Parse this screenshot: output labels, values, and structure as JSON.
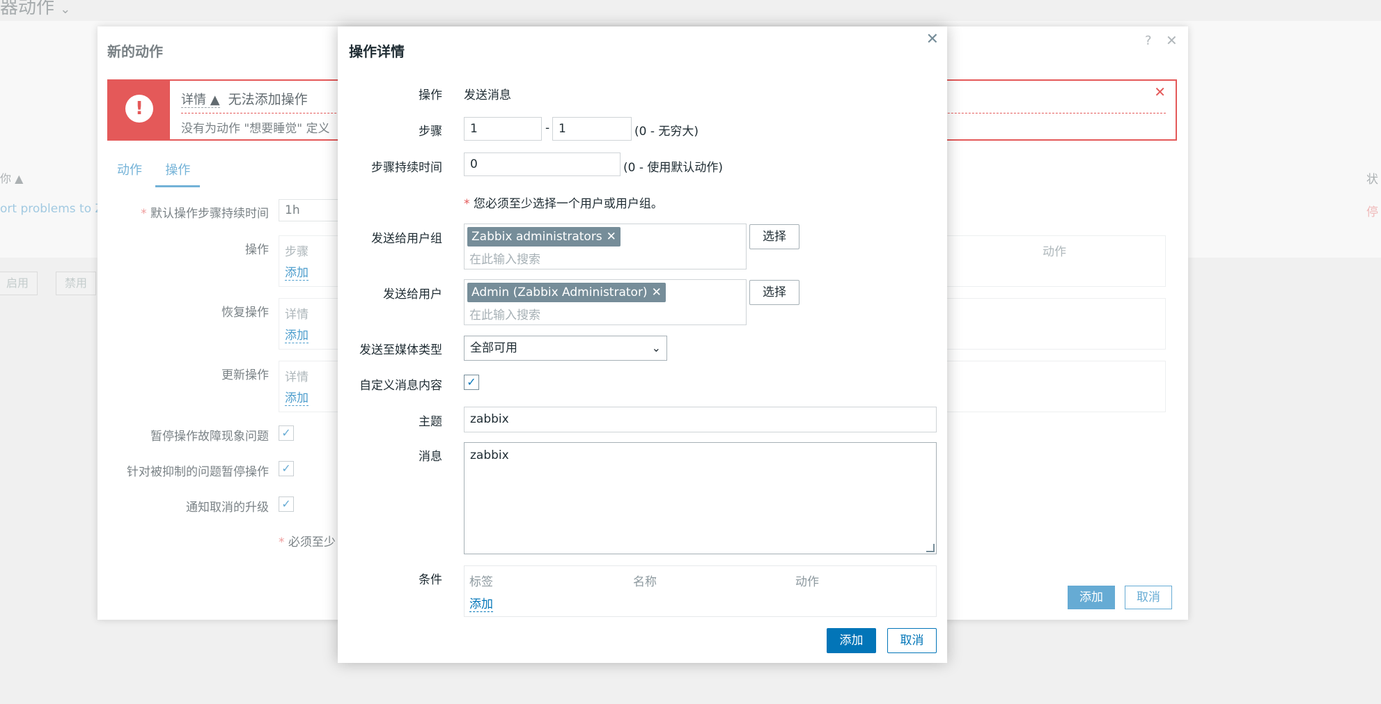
{
  "background": {
    "page_title": "器动作",
    "col_sort": "你 ▲",
    "col_status": "状",
    "row_name": "ort problems to Z",
    "row_status": "停",
    "btn_enable": "启用",
    "btn_disable": "禁用"
  },
  "action_modal": {
    "title": "新的动作",
    "help_icon": "?",
    "close_icon": "✕",
    "alert": {
      "details_label": "详情 ▲",
      "title": "无法添加操作",
      "message": "没有为动作 \"想要睡觉\" 定义",
      "close": "✕"
    },
    "tabs": [
      "动作",
      "操作"
    ],
    "default_step_label": "默认操作步骤持续时间",
    "default_step_value": "1h",
    "operations_label": "操作",
    "operations_header_step": "步骤",
    "operations_header_action": "动作",
    "recovery_label": "恢复操作",
    "update_label": "更新操作",
    "details_header": "详情",
    "add_link": "添加",
    "pause_symptoms_label": "暂停操作故障现象问题",
    "pause_suppressed_label": "针对被抑制的问题暂停操作",
    "notify_cancel_label": "通知取消的升级",
    "required_note": "必须至少",
    "add_button": "添加",
    "cancel_button": "取消"
  },
  "op_modal": {
    "title": "操作详情",
    "close_icon": "✕",
    "operation_label": "操作",
    "operation_value": "发送消息",
    "steps_label": "步骤",
    "step_from": "1",
    "step_sep": "-",
    "step_to": "1",
    "steps_hint": "(0 - 无穷大)",
    "step_duration_label": "步骤持续时间",
    "step_duration_value": "0",
    "step_duration_hint": "(0 - 使用默认动作)",
    "required_note": "您必须至少选择一个用户或用户组。",
    "send_groups_label": "发送给用户组",
    "group_tag": "Zabbix administrators",
    "send_users_label": "发送给用户",
    "user_tag": "Admin (Zabbix Administrator)",
    "search_placeholder": "在此输入搜索",
    "select_button": "选择",
    "media_label": "发送至媒体类型",
    "media_value": "全部可用",
    "custom_msg_label": "自定义消息内容",
    "subject_label": "主题",
    "subject_value": "zabbix",
    "message_label": "消息",
    "message_value": "zabbix",
    "conditions_label": "条件",
    "cond_col_label": "标签",
    "cond_col_name": "名称",
    "cond_col_action": "动作",
    "add_link": "添加",
    "add_button": "添加",
    "cancel_button": "取消"
  },
  "colors": {
    "accent": "#0275b8",
    "error": "#e45959",
    "tag_bg": "#768d99"
  }
}
